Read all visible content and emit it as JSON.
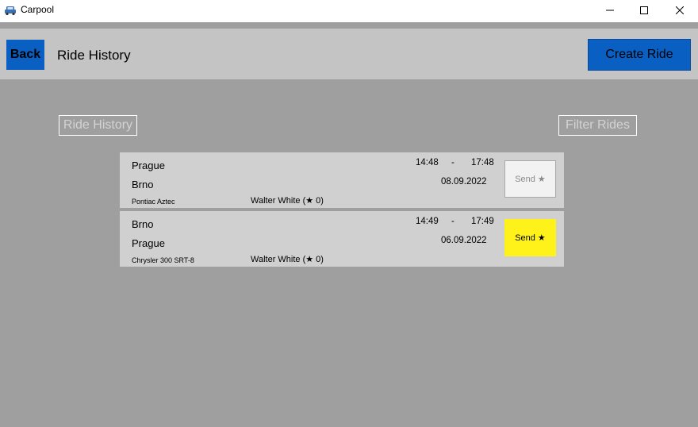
{
  "window": {
    "title": "Carpool",
    "icon": "car-icon",
    "controls": [
      "minimize-icon",
      "maximize-icon",
      "close-icon"
    ]
  },
  "header": {
    "back_label": "Back",
    "title": "Ride History",
    "create_label": "Create Ride"
  },
  "sections": {
    "history_label": "Ride History",
    "filter_label": "Filter Rides"
  },
  "rides": [
    {
      "from": "Prague",
      "to": "Brno",
      "car": "Pontiac Aztec",
      "driver": "Walter White (★ 0)",
      "depart": "14:48",
      "dash": "-",
      "arrive": "17:48",
      "date": "08.09.2022",
      "send_label": "Send ★",
      "send_active": false
    },
    {
      "from": "Brno",
      "to": "Prague",
      "car": "Chrysler 300 SRT-8",
      "driver": "Walter White (★ 0)",
      "depart": "14:49",
      "dash": "-",
      "arrive": "17:49",
      "date": "06.09.2022",
      "send_label": "Send ★",
      "send_active": true
    }
  ],
  "colors": {
    "accent": "#0a5fc2",
    "header_bg": "#c4c4c4",
    "body_bg": "#9f9f9f",
    "card_bg": "#d0d0d0",
    "send_active": "#fff21a"
  }
}
